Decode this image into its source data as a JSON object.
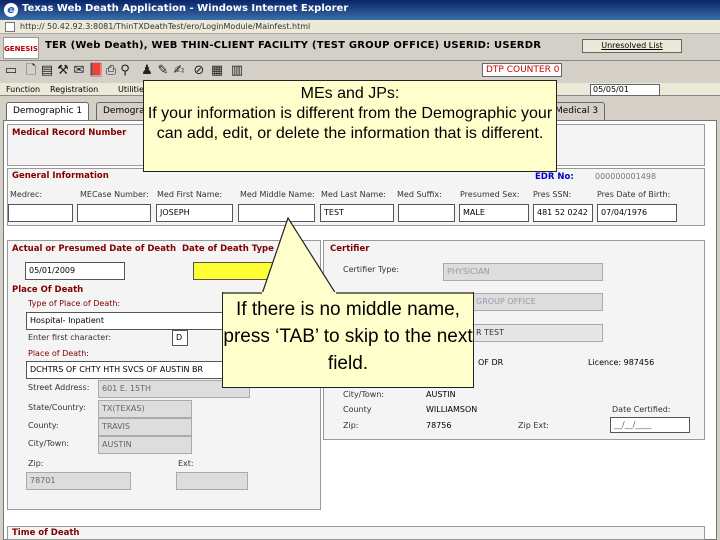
{
  "window": {
    "title": "Texas Web Death Application - Windows Internet Explorer",
    "address": "http:// 50.42.92.3:8081/ThinTXDeathTest/ero/LoginModule/Mainfest.html"
  },
  "header": {
    "logo_text": "GENESIS",
    "title": "TER (Web Death), WEB THIN-CLIENT FACILITY (TEST GROUP OFFICE) USERID: USERDR",
    "unresolved_label": "Unresolved List",
    "dtp_counter": "DTP COUNTER 0",
    "date_value": "05/05/01"
  },
  "menu": [
    "Function",
    "Registration",
    "Utilities"
  ],
  "tabs": [
    {
      "label": "Demographic 1",
      "active": true
    },
    {
      "label": "Demograp",
      "active": false
    },
    {
      "label": "Medical 3",
      "active": false
    }
  ],
  "medical_record": {
    "label": "Medical Record Number"
  },
  "general": {
    "section_label": "General Information",
    "edr_label": "EDR No:",
    "edr_value": "000000001498",
    "columns": [
      "Medrec:",
      "MECase Number:",
      "Med First Name:",
      "Med Middle Name:",
      "Med Last Name:",
      "Med Suffix:",
      "Presumed Sex:",
      "Pres SSN:",
      "Pres Date of Birth:"
    ],
    "values": [
      "",
      "",
      "JOSEPH",
      "",
      "TEST",
      "",
      "MALE",
      "481 52 0242",
      "07/04/1976"
    ]
  },
  "death": {
    "section_label": "Actual or Presumed Date of Death",
    "type_label": "Date of Death Type",
    "date_value": "05/01/2009",
    "place_label": "Place Of Death",
    "type_place_label": "Type of Place of Death:",
    "type_place_value": "Hospital- Inpatient",
    "enter_first_label": "Enter first character:",
    "enter_first_value": "D",
    "place_of_death_label": "Place of Death:",
    "place_of_death_value": "DCHTRS OF CHTY HTH SVCS OF AUSTIN BR",
    "street_label": "Street Address:",
    "street_value": "601 E. 15TH",
    "state_label": "State/Country:",
    "state_value": "TX(TEXAS)",
    "county_label": "County:",
    "county_value": "TRAVIS",
    "city_label": "City/Town:",
    "city_value": "AUSTIN",
    "zip_label": "Zip:",
    "zip_value": "78701",
    "ext_label": "Ext:",
    "ext_value": "",
    "time_label": "Time of Death"
  },
  "certifier": {
    "section_label": "Certifier",
    "type_label": "Certifier Type:",
    "type_value": "PHYSICIAN",
    "office_value": "GROUP OFFICE",
    "name_value": "R TEST",
    "of_dr": "OF DR",
    "license_label": "Licence: 987456",
    "city_label": "City/Town:",
    "city_value": "AUSTIN",
    "county_label": "County",
    "county_value": "WILLIAMSON",
    "zip_label": "Zip:",
    "zip_value": "78756",
    "zip_ext_label": "Zip Ext:",
    "date_certified_label": "Date Certified:",
    "date_certified_value": "__/__/____"
  },
  "callouts": {
    "top": "MEs and JPs:\nIf your information is different from the Demographic your can add, edit, or delete the information that is different.",
    "middle": "If there is no middle name, press ‘TAB’ to skip to the next field."
  }
}
